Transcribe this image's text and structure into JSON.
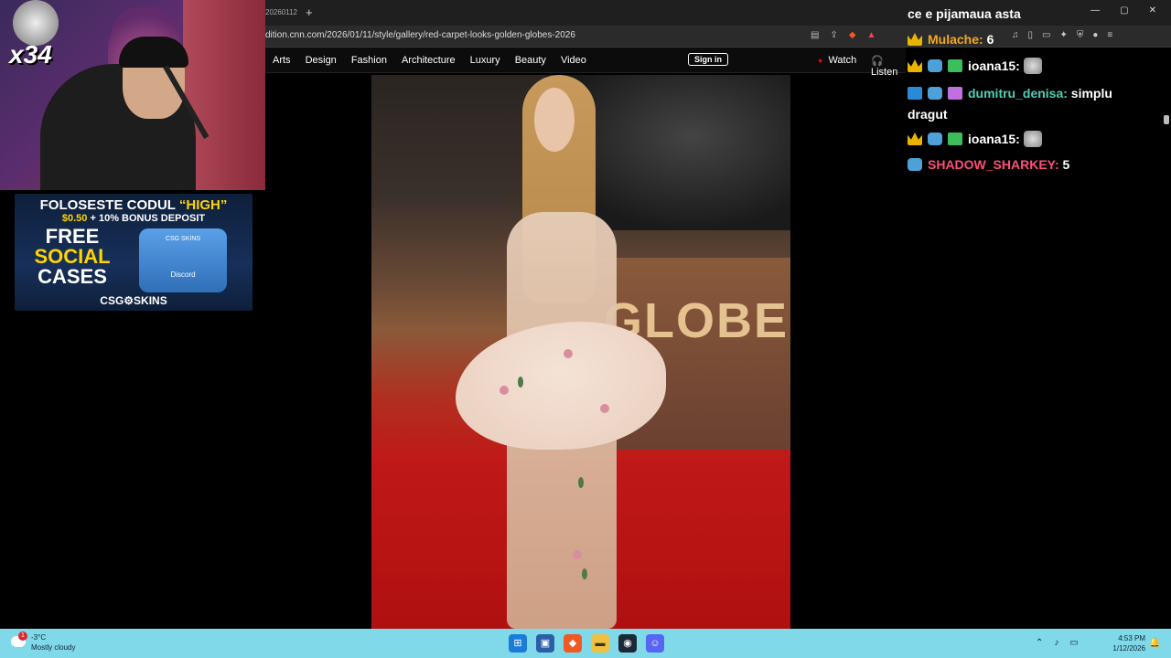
{
  "browser": {
    "tab_title": "20260112",
    "new_tab": "+",
    "url": "dition.cnn.com/2026/01/11/style/gallery/red-carpet-looks-golden-globes-2026",
    "window_controls": [
      "—",
      "▢",
      "✕"
    ]
  },
  "site_nav": {
    "links": [
      "Arts",
      "Design",
      "Fashion",
      "Architecture",
      "Luxury",
      "Beauty",
      "Video"
    ],
    "watch": "Watch",
    "listen": "Listen",
    "sign_in": "Sign in"
  },
  "photo": {
    "backdrop_text": "GLOBE"
  },
  "webcam": {
    "multiplier": "x34"
  },
  "ad": {
    "line1_prefix": "FOLOSESTE CODUL ",
    "line1_code": "“HIGH”",
    "line2_amount": "$0.50",
    "line2_rest": " + 10% BONUS DEPOSIT",
    "free1": "FREE",
    "free2": "SOCIAL",
    "free3": "CASES",
    "case_label": "CSG SKINS",
    "case_discord": "Discord",
    "brand": "CSG⚙SKINS"
  },
  "chat": {
    "messages": [
      {
        "user": "",
        "text": "ce e pijamaua asta"
      },
      {
        "user": "Mulache:",
        "text": "6"
      },
      {
        "user": "ioana15:",
        "text": ""
      },
      {
        "user": "dumitru_denisa:",
        "text": "simplu"
      },
      {
        "user": "",
        "text": "dragut"
      },
      {
        "user": "ioana15:",
        "text": ""
      },
      {
        "user": "SHADOW_SHARKEY:",
        "text": "5"
      }
    ]
  },
  "taskbar": {
    "weather_temp": "-3°C",
    "weather_desc": "Mostly cloudy",
    "notification_count": "1",
    "time": "4:53 PM",
    "date": "1/12/2026"
  },
  "colors": {
    "taskbar": "#7fd9e8",
    "chat_orange": "#f2a820",
    "chat_teal": "#4fd0b6",
    "chat_pink": "#ff4f7a",
    "live_dot": "#e00000"
  }
}
